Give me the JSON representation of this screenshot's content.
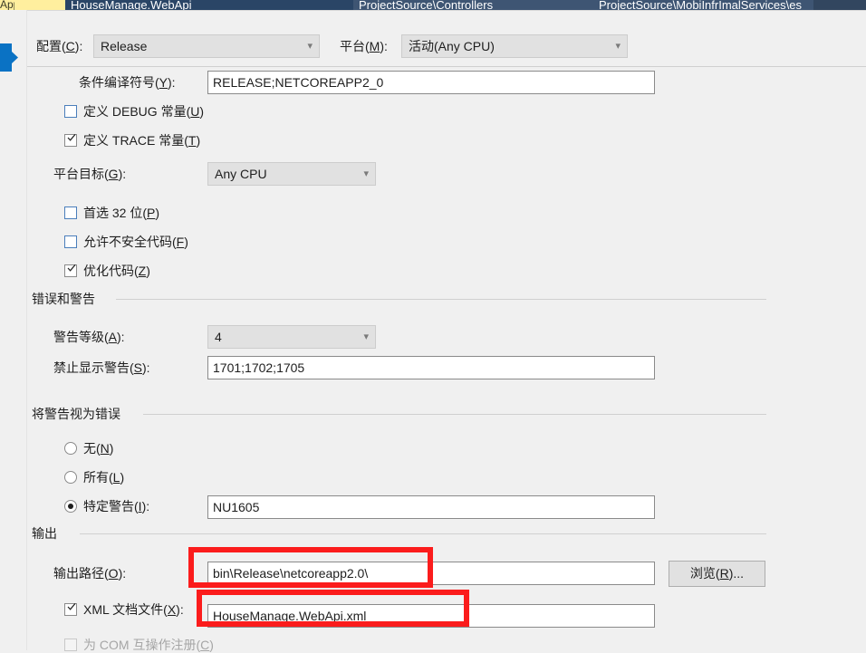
{
  "window": {
    "tabs": [
      {
        "label": "App;",
        "state": "dirty"
      },
      {
        "label": "HouseManage.WebApi",
        "state": "active"
      },
      {
        "label": "ProjectSource\\Controllers",
        "state": "plain"
      },
      {
        "label": "ProjectSource\\MobiInfrImalServices\\es",
        "state": "plain"
      }
    ]
  },
  "toolbar": {
    "configuration_label": "配置(C):",
    "configuration_accesskey": "C",
    "configuration_value": "Release",
    "platform_label": "平台(M):",
    "platform_accesskey": "M",
    "platform_value": "活动(Any CPU)"
  },
  "general": {
    "conditional_symbols_label": "条件编译符号(Y):",
    "conditional_symbols_accesskey": "Y",
    "conditional_symbols_value": "RELEASE;NETCOREAPP2_0",
    "define_debug_label": "定义 DEBUG 常量(U)",
    "define_debug_accesskey": "U",
    "define_debug_checked": false,
    "define_trace_label": "定义 TRACE 常量(T)",
    "define_trace_accesskey": "T",
    "define_trace_checked": true,
    "platform_target_label": "平台目标(G):",
    "platform_target_accesskey": "G",
    "platform_target_value": "Any CPU",
    "prefer_32bit_label": "首选 32 位(P)",
    "prefer_32bit_accesskey": "P",
    "prefer_32bit_checked": false,
    "allow_unsafe_label": "允许不安全代码(F)",
    "allow_unsafe_accesskey": "F",
    "allow_unsafe_checked": false,
    "optimize_code_label": "优化代码(Z)",
    "optimize_code_accesskey": "Z",
    "optimize_code_checked": true
  },
  "errors_warnings": {
    "group_title": "错误和警告",
    "warning_level_label": "警告等级(A):",
    "warning_level_accesskey": "A",
    "warning_level_value": "4",
    "suppress_warnings_label": "禁止显示警告(S):",
    "suppress_warnings_accesskey": "S",
    "suppress_warnings_value": "1701;1702;1705"
  },
  "treat_warnings": {
    "group_title": "将警告视为错误",
    "none_label": "无(N)",
    "none_accesskey": "N",
    "none_selected": false,
    "all_label": "所有(L)",
    "all_accesskey": "L",
    "all_selected": false,
    "specific_label": "特定警告(I):",
    "specific_accesskey": "I",
    "specific_selected": true,
    "specific_value": "NU1605"
  },
  "output": {
    "group_title": "输出",
    "output_path_label": "输出路径(O):",
    "output_path_accesskey": "O",
    "output_path_value": "bin\\Release\\netcoreapp2.0\\",
    "browse_label": "浏览(R)...",
    "browse_accesskey": "R",
    "xml_doc_label": "XML 文档文件(X):",
    "xml_doc_accesskey": "X",
    "xml_doc_checked": true,
    "xml_doc_value": "HouseManage.WebApi.xml",
    "register_com_label": "为 COM 互操作注册(C)",
    "register_com_accesskey": "C",
    "register_com_checked": false,
    "register_com_disabled": true
  },
  "annotations": {
    "highlight_color": "#fb1c1c",
    "accent_color": "#0a72c4",
    "boxes": [
      {
        "name": "output-path-highlight"
      },
      {
        "name": "xml-doc-highlight"
      }
    ]
  }
}
